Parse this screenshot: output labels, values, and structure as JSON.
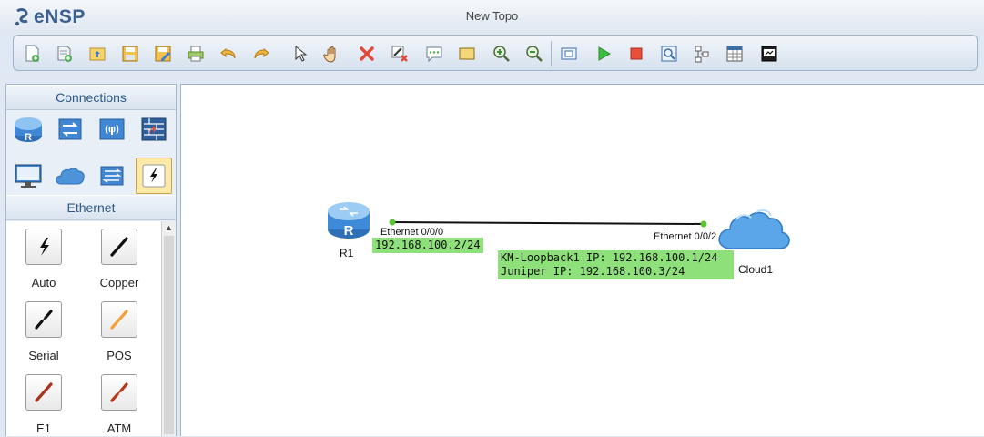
{
  "app": {
    "logo_text": "eNSP",
    "window_title": "New Topo"
  },
  "toolbar": {
    "buttons": [
      {
        "name": "new-topology",
        "icon": "new-file-icon"
      },
      {
        "name": "new-from-template",
        "icon": "new-template-icon"
      },
      {
        "name": "open",
        "icon": "open-folder-icon"
      },
      {
        "name": "save",
        "icon": "save-icon"
      },
      {
        "name": "save-as",
        "icon": "save-as-icon"
      },
      {
        "name": "print",
        "icon": "print-icon"
      },
      {
        "name": "undo",
        "icon": "undo-icon"
      },
      {
        "name": "redo",
        "icon": "redo-icon"
      },
      {
        "name": "select",
        "icon": "cursor-icon"
      },
      {
        "name": "pan",
        "icon": "hand-icon"
      },
      {
        "name": "delete",
        "icon": "delete-icon"
      },
      {
        "name": "delete-connections",
        "icon": "delete-link-icon"
      },
      {
        "name": "add-text",
        "icon": "comment-icon"
      },
      {
        "name": "add-shape",
        "icon": "rectangle-icon"
      },
      {
        "name": "zoom-in",
        "icon": "zoom-in-icon"
      },
      {
        "name": "zoom-out",
        "icon": "zoom-out-icon"
      },
      {
        "name": "fit-view",
        "icon": "fit-view-icon"
      },
      {
        "name": "start-device",
        "icon": "play-icon"
      },
      {
        "name": "stop-device",
        "icon": "stop-icon"
      },
      {
        "name": "capture-data",
        "icon": "capture-icon"
      },
      {
        "name": "topology-view",
        "icon": "topology-icon"
      },
      {
        "name": "show-grid",
        "icon": "grid-icon"
      },
      {
        "name": "show-interface",
        "icon": "interface-icon"
      }
    ]
  },
  "left_panel": {
    "devices_header": "Connections",
    "devices": [
      {
        "name": "router",
        "icon": "router-icon"
      },
      {
        "name": "switch",
        "icon": "switch-icon"
      },
      {
        "name": "wlan",
        "icon": "wireless-icon"
      },
      {
        "name": "firewall",
        "icon": "firewall-icon"
      },
      {
        "name": "terminal",
        "icon": "pc-icon"
      },
      {
        "name": "cloud",
        "icon": "cloud-icon"
      },
      {
        "name": "other-devices",
        "icon": "hub-icon"
      },
      {
        "name": "connections",
        "icon": "lightning-icon",
        "selected": true
      }
    ],
    "cables_header": "Ethernet",
    "cables": [
      {
        "label": "Auto",
        "color": "#222222"
      },
      {
        "label": "Copper",
        "color": "#111111"
      },
      {
        "label": "Serial",
        "color": "#111111"
      },
      {
        "label": "POS",
        "color": "#f2a03a"
      },
      {
        "label": "E1",
        "color": "#a8321c"
      },
      {
        "label": "ATM",
        "color": "#b5371e"
      }
    ]
  },
  "canvas": {
    "router": {
      "label": "R1",
      "port": "Ethernet 0/0/0",
      "ip": "192.168.100.2/24"
    },
    "cloud": {
      "label": "Cloud1",
      "port": "Ethernet 0/0/2"
    },
    "cloud_note": [
      "KM-Loopback1 IP: 192.168.100.1/24",
      "Juniper IP: 192.168.100.3/24"
    ],
    "link_color": "#111111",
    "note_color": "#8ee07a"
  }
}
